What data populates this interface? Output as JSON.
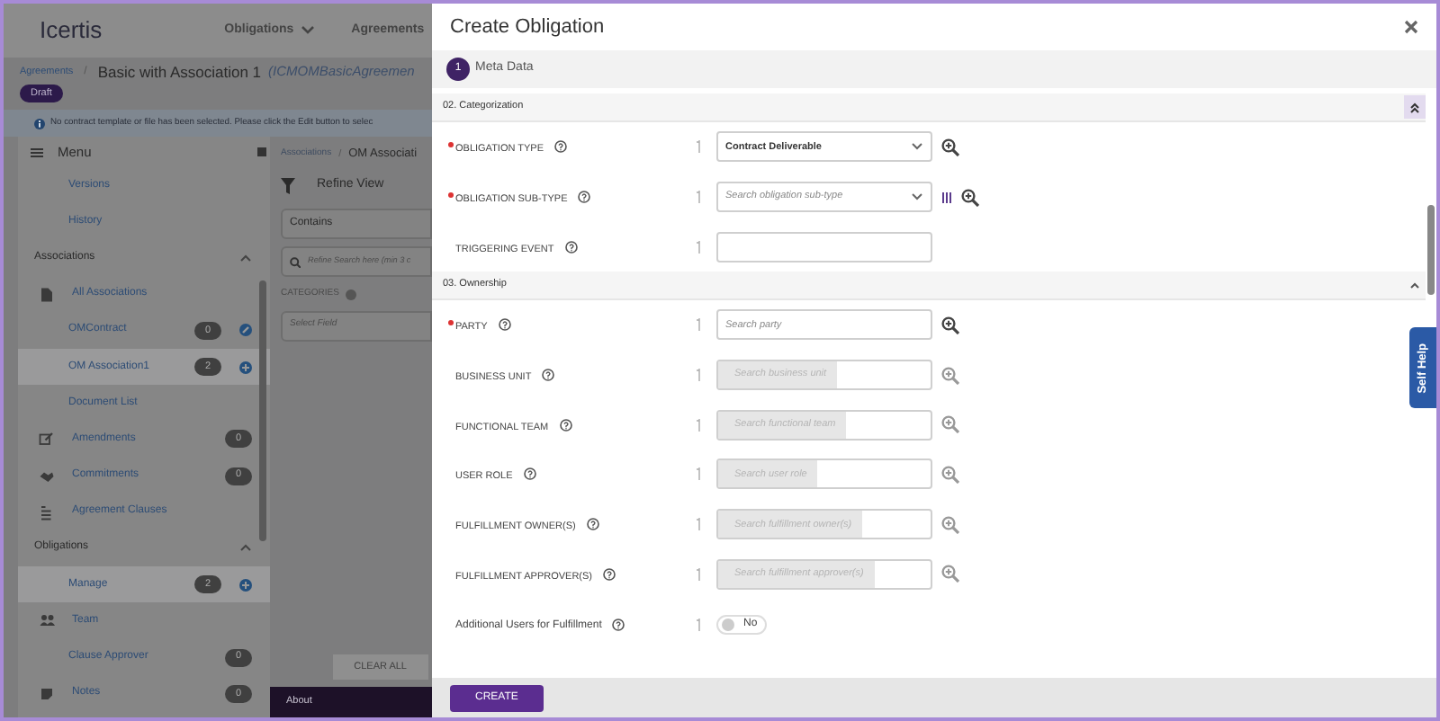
{
  "background": {
    "nav": [
      "Obligations",
      "Agreements"
    ],
    "nav_dropdown": [
      true,
      false
    ],
    "logo": "Icertis",
    "breadcrumb": {
      "parent": "Agreements",
      "separator": "/",
      "title": "Basic with Association 1",
      "code": "(ICMOMBasicAgreemen"
    },
    "status_badge": "Draft",
    "info": "No contract template or file has been selected. Please click the Edit button to selec",
    "menu": {
      "title": "Menu",
      "items": [
        {
          "kind": "link",
          "label": "Versions"
        },
        {
          "kind": "link",
          "label": "History"
        },
        {
          "kind": "header",
          "label": "Associations",
          "expanded": true
        },
        {
          "kind": "document",
          "label": "All Associations"
        },
        {
          "kind": "link",
          "label": "OMContract",
          "count": "0",
          "edit_button": true,
          "add_button": false,
          "selected": false
        },
        {
          "kind": "link",
          "label": "OM Association1",
          "count": "2",
          "edit_button": false,
          "add_button": true,
          "selected": true
        },
        {
          "kind": "link",
          "label": "Document List"
        },
        {
          "kind": "amendment",
          "label": "Amendments",
          "count": "0"
        },
        {
          "kind": "commitment",
          "label": "Commitments",
          "count": "0"
        },
        {
          "kind": "clauses",
          "label": "Agreement Clauses"
        },
        {
          "kind": "header",
          "label": "Obligations",
          "expanded": true
        },
        {
          "kind": "link",
          "label": "Manage",
          "count": "2",
          "edit_button": false,
          "add_button": true,
          "selected": true
        },
        {
          "kind": "team",
          "label": "Team"
        },
        {
          "kind": "link",
          "label": "Clause Approver",
          "count": "0"
        },
        {
          "kind": "notes",
          "label": "Notes",
          "count": "0"
        }
      ]
    },
    "panel": {
      "breadcrumb_parent": "Associations",
      "separator": "/",
      "breadcrumb_current": "OM Associati",
      "filter_title": "Refine View",
      "operator": "Contains",
      "search_placeholder": "Refine Search here (min 3 c",
      "categories_label": "CATEGORIES",
      "field_placeholder": "Select Field",
      "clear_button": "CLEAR ALL",
      "footer": "About"
    }
  },
  "dialog": {
    "title": "Create Obligation",
    "steps": [
      {
        "number": "1",
        "label": "Meta Data",
        "selected": true
      }
    ],
    "sections": [
      {
        "title": "02. Categorization",
        "expanded": true,
        "fields": [
          {
            "kind": "select",
            "label": "OBLIGATION TYPE",
            "required": true,
            "value": "Contract Deliverable",
            "lookup": true,
            "columns": false
          },
          {
            "kind": "select",
            "label": "OBLIGATION SUB-TYPE",
            "required": true,
            "placeholder": "Search obligation sub-type",
            "lookup": true,
            "columns": true
          },
          {
            "kind": "text",
            "label": "TRIGGERING EVENT",
            "required": false
          }
        ]
      },
      {
        "title": "03. Ownership",
        "expanded": true,
        "fields": [
          {
            "kind": "search",
            "label": "PARTY",
            "required": true,
            "placeholder": "Search party",
            "lookup": true,
            "disabled": false
          },
          {
            "kind": "search",
            "label": "BUSINESS UNIT",
            "required": false,
            "placeholder": "Search business unit",
            "lookup": true,
            "disabled": true
          },
          {
            "kind": "search",
            "label": "FUNCTIONAL TEAM",
            "required": false,
            "placeholder": "Search functional team",
            "lookup": true,
            "disabled": true
          },
          {
            "kind": "search",
            "label": "USER ROLE",
            "required": false,
            "placeholder": "Search user role",
            "lookup": true,
            "disabled": true
          },
          {
            "kind": "search",
            "label": "FULFILLMENT OWNER(S)",
            "required": false,
            "placeholder": "Search fulfillment owner(s)",
            "lookup": true,
            "disabled": true
          },
          {
            "kind": "search",
            "label": "FULFILLMENT APPROVER(S)",
            "required": false,
            "placeholder": "Search fulfillment approver(s)",
            "lookup": true,
            "disabled": true
          },
          {
            "kind": "toggle",
            "label": "Additional Users for Fulfillment",
            "required": false,
            "on": false,
            "value": "No"
          }
        ]
      }
    ],
    "create_button": "CREATE"
  },
  "self_help": "Self Help"
}
